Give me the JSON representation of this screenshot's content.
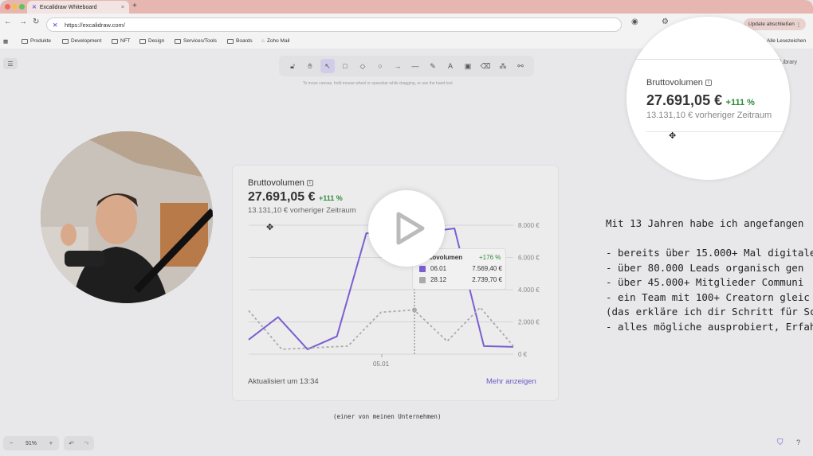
{
  "browser": {
    "tab_title": "Excalidraw Whiteboard",
    "url": "https://excalidraw.com/",
    "update_button": "Update abschließen",
    "bookmarks": [
      "Produkte",
      "Development",
      "NFT",
      "Design",
      "Services/Tools",
      "Boards",
      "Zoho Mail"
    ],
    "all_bookmarks": "Alle Lesezeichen"
  },
  "excalidraw": {
    "hint": "To move canvas, hold mouse wheel or spacebar while dragging, or use the hand tool",
    "library": "Library",
    "zoom": "91%",
    "caption": "(einer von meinen Unternehmen)"
  },
  "card": {
    "title": "Bruttovolumen",
    "value": "27.691,05 €",
    "change": "+111 %",
    "previous": "13.131,10 € vorheriger Zeitraum",
    "updated": "Aktualisiert um 13:34",
    "more": "Mehr anzeigen"
  },
  "tooltip": {
    "title": "ttovolumen",
    "change": "+176 %",
    "rows": [
      {
        "label": "06.01",
        "value": "7.569,40 €",
        "color": "#7b5fd0"
      },
      {
        "label": "28.12",
        "value": "2.739,70 €",
        "color": "#aaaaaa"
      }
    ]
  },
  "zoom_view": {
    "title": "Bruttovolumen",
    "value": "27.691,05 €",
    "change": "+111 %",
    "previous": "13.131,10 € vorheriger Zeitraum"
  },
  "notes": [
    "Mit 13 Jahren habe ich angefangen",
    "",
    "- bereits über 15.000+ Mal digitale",
    "- über 80.000 Leads organisch gen",
    "- über 45.000+ Mitglieder Communi",
    "- ein Team mit 100+ Creatorn gleic",
    "(das erkläre ich dir Schritt für Sc",
    "- alles mögliche ausprobiert, Erfah"
  ],
  "chart_data": {
    "type": "line",
    "x_tick_labels": [
      "05.01"
    ],
    "y_tick_labels": [
      "8.000 €",
      "6.000 €",
      "4.000 €",
      "2.000 €",
      "0 €"
    ],
    "ylim": [
      0,
      8000
    ],
    "series": [
      {
        "color": "#7b5fd0",
        "style": "solid",
        "values": [
          900,
          2300,
          300,
          1100,
          7500,
          7600,
          7569,
          7800,
          500,
          450
        ]
      },
      {
        "color": "#aaaaaa",
        "style": "dotted",
        "values": [
          2700,
          300,
          400,
          500,
          2600,
          2739,
          800,
          2900,
          500
        ]
      }
    ],
    "grid": true
  }
}
